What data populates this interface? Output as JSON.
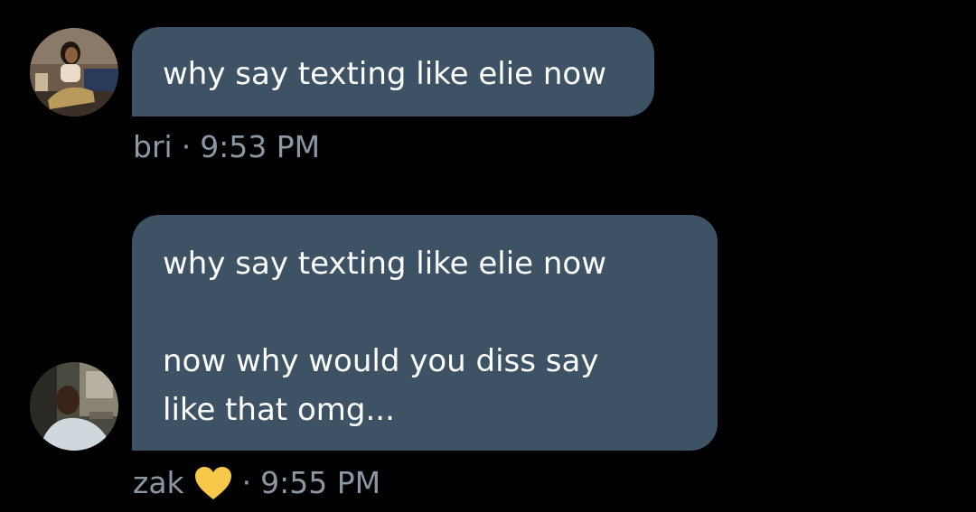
{
  "messages": [
    {
      "sender": "bri",
      "avatar_icon": "profile-photo",
      "lines": [
        "why say texting like elie now"
      ],
      "time": "9:53 PM"
    },
    {
      "sender": "zak",
      "avatar_icon": "profile-photo",
      "lines": [
        "why say texting like elie now",
        "",
        "now why would you diss say",
        "like that omg..."
      ],
      "reaction_icon": "yellow-heart-icon",
      "time": "9:55 PM"
    }
  ],
  "separator": "·",
  "colors": {
    "background": "#000000",
    "bubble": "#3e5266",
    "meta_text": "#8a98a5",
    "heart": "#f7c94b"
  }
}
